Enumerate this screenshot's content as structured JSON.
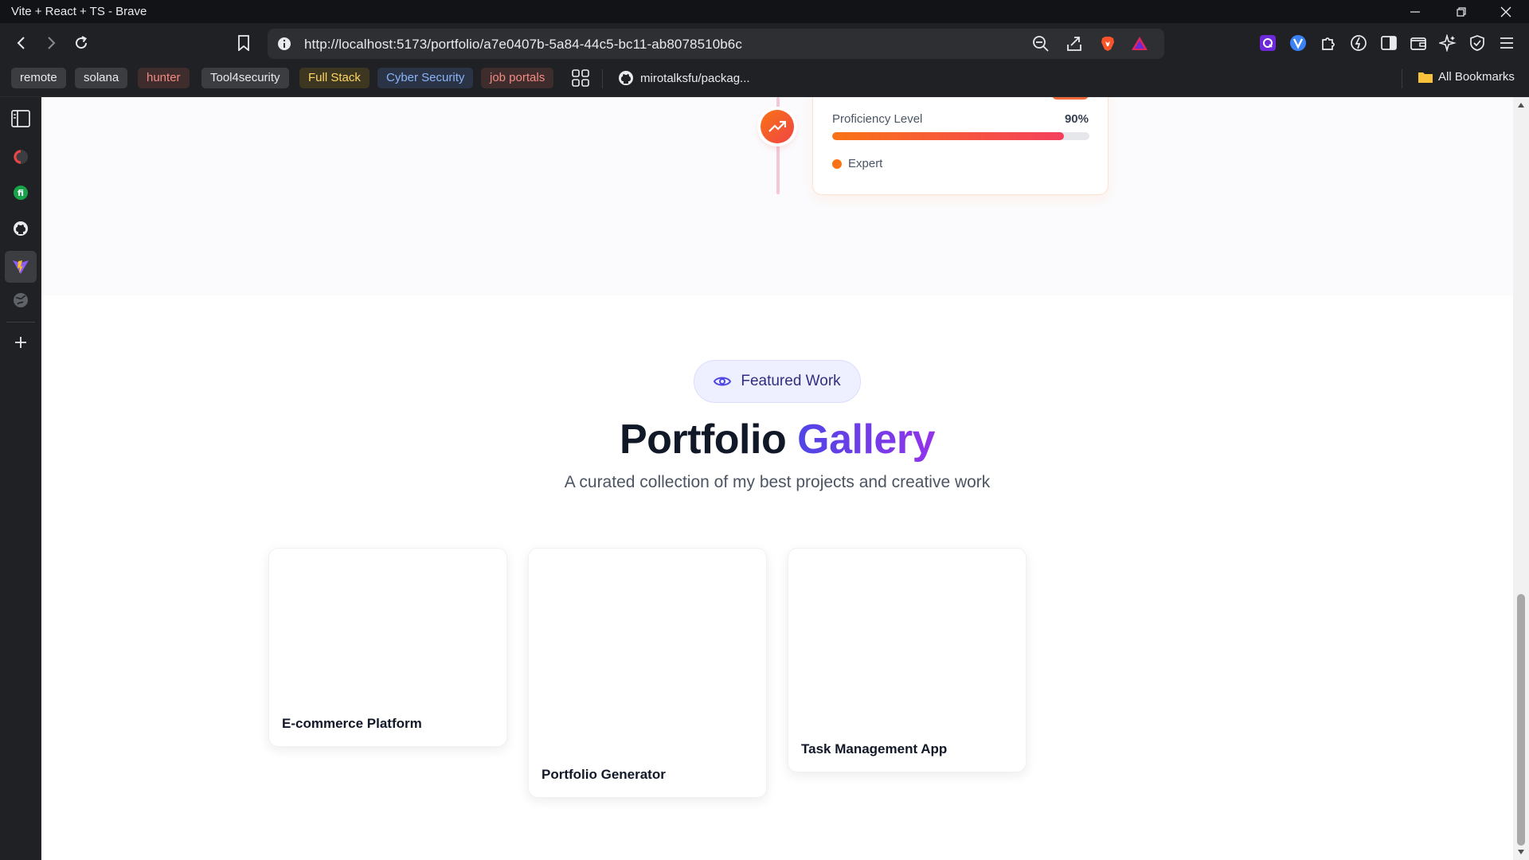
{
  "window": {
    "title": "Vite + React + TS - Brave"
  },
  "toolbar": {
    "url": "http://localhost:5173/portfolio/a7e0407b-5a84-44c5-bc11-ab8078510b6c"
  },
  "bookmarks": {
    "items": [
      {
        "label": "remote",
        "color": "#e8eaed",
        "bg": "#3c3d41"
      },
      {
        "label": "solana",
        "color": "#e8eaed",
        "bg": "#3c3d41"
      },
      {
        "label": "hunter",
        "color": "#f28b82",
        "bg": "#3f2c2c"
      },
      {
        "label": "Tool4security",
        "color": "#e8eaed",
        "bg": "#3c3d41"
      },
      {
        "label": "Full Stack",
        "color": "#fdd663",
        "bg": "#3d3620"
      },
      {
        "label": "Cyber Security",
        "color": "#8ab4f8",
        "bg": "#2b3446"
      },
      {
        "label": "job portals",
        "color": "#f28b82",
        "bg": "#3f2c2c"
      }
    ],
    "github_link": "mirotalksfu/packag...",
    "all_bookmarks": "All Bookmarks"
  },
  "skill_card": {
    "proficiency_label": "Proficiency Level",
    "proficiency_value": "90%",
    "proficiency_fraction": 0.9,
    "level": "Expert"
  },
  "gallery": {
    "badge": "Featured Work",
    "title_main": "Portfolio",
    "title_accent": "Gallery",
    "subtitle": "A curated collection of my best projects and creative work",
    "projects": [
      {
        "name": "E-commerce Platform"
      },
      {
        "name": "Portfolio Generator"
      },
      {
        "name": "Task Management App"
      }
    ]
  },
  "colors": {
    "accent_orange": "#f97316",
    "accent_purple": "#7c3aed"
  }
}
